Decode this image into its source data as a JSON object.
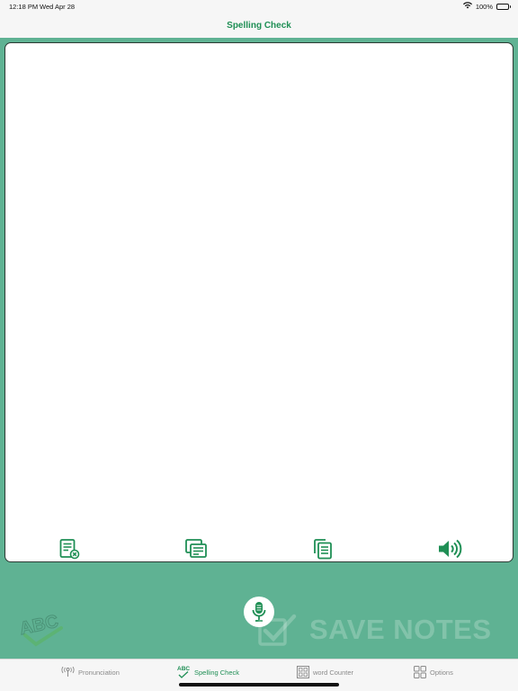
{
  "status_bar": {
    "time": "12:18 PM",
    "date": "Wed Apr 28",
    "battery": "100%"
  },
  "nav": {
    "title": "Spelling Check"
  },
  "editor": {
    "text": ""
  },
  "toolbar": [
    {
      "id": "clear",
      "icon": "clear-text-icon"
    },
    {
      "id": "paste",
      "icon": "paste-icon"
    },
    {
      "id": "copy",
      "icon": "copy-icon"
    },
    {
      "id": "speak",
      "icon": "speaker-icon"
    }
  ],
  "save_notes": {
    "label": "SAVE NOTES"
  },
  "tabs": [
    {
      "label": "Pronunciation",
      "icon": "pronunciation-icon",
      "active": false
    },
    {
      "label": "Spelling Check",
      "icon": "abc-check-icon",
      "active": true
    },
    {
      "label": "word Counter",
      "icon": "word-counter-icon",
      "active": false
    },
    {
      "label": "Options",
      "icon": "grid-icon",
      "active": false
    }
  ],
  "colors": {
    "accent": "#1f8f55",
    "background_green": "#5fb293",
    "tab_inactive": "#8a8a8a"
  }
}
